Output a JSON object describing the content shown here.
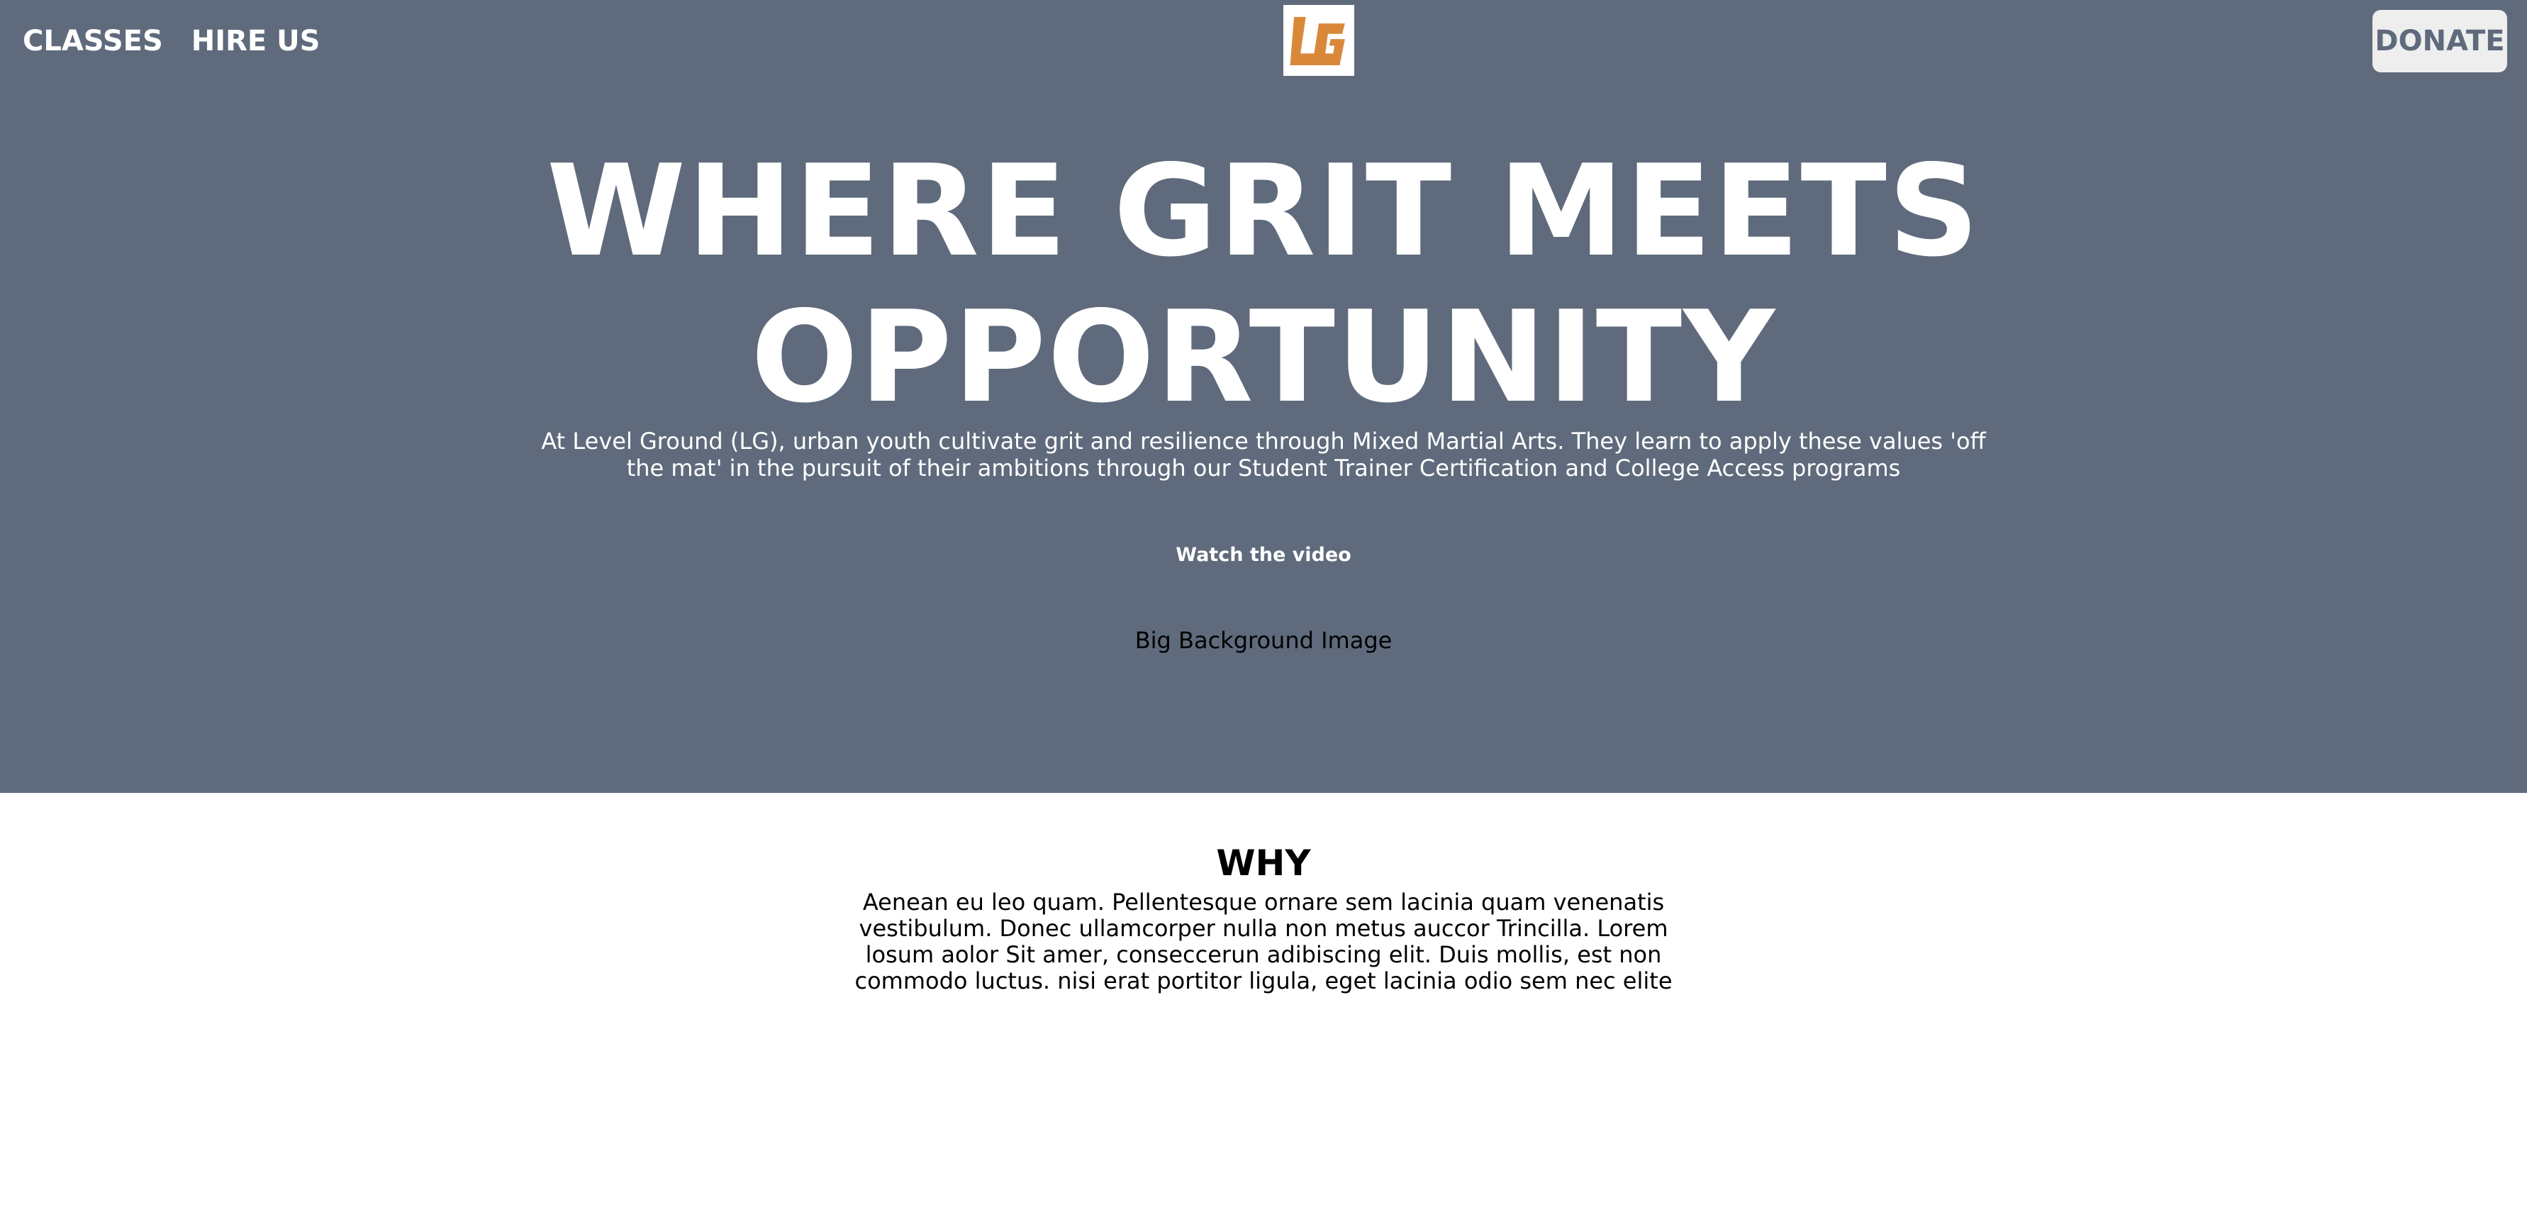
{
  "nav": {
    "classes_label": "CLASSES",
    "hire_label": "HIRE US",
    "donate_label": "DONATE",
    "logo_text": "LG"
  },
  "hero": {
    "headline_line1": "WHERE GRIT MEETS",
    "headline_line2": "OPPORTUNITY",
    "subtitle": "At Level Ground (LG), urban youth cultivate grit and resilience through Mixed Martial Arts. They learn to apply these values 'off the mat' in the pursuit of their ambitions through our Student Trainer Certification and College Access programs",
    "watch_video": "Watch the video",
    "background_label": "Big Background Image"
  },
  "why": {
    "heading": "WHY",
    "body": "Aenean eu leo quam. Pellentesque ornare sem lacinia quam venenatis vestibulum. Donec ullamcorper nulla non metus auccor Trincilla. Lorem losum aolor Sit amer, conseccerun adibiscing elit. Duis mollis, est non commodo luctus. nisi erat portitor ligula, eget lacinia odio sem nec elite"
  },
  "colors": {
    "hero_bg": "#5f6b7c",
    "logo_orange": "#d9883a",
    "donate_bg": "#eeeeee"
  }
}
